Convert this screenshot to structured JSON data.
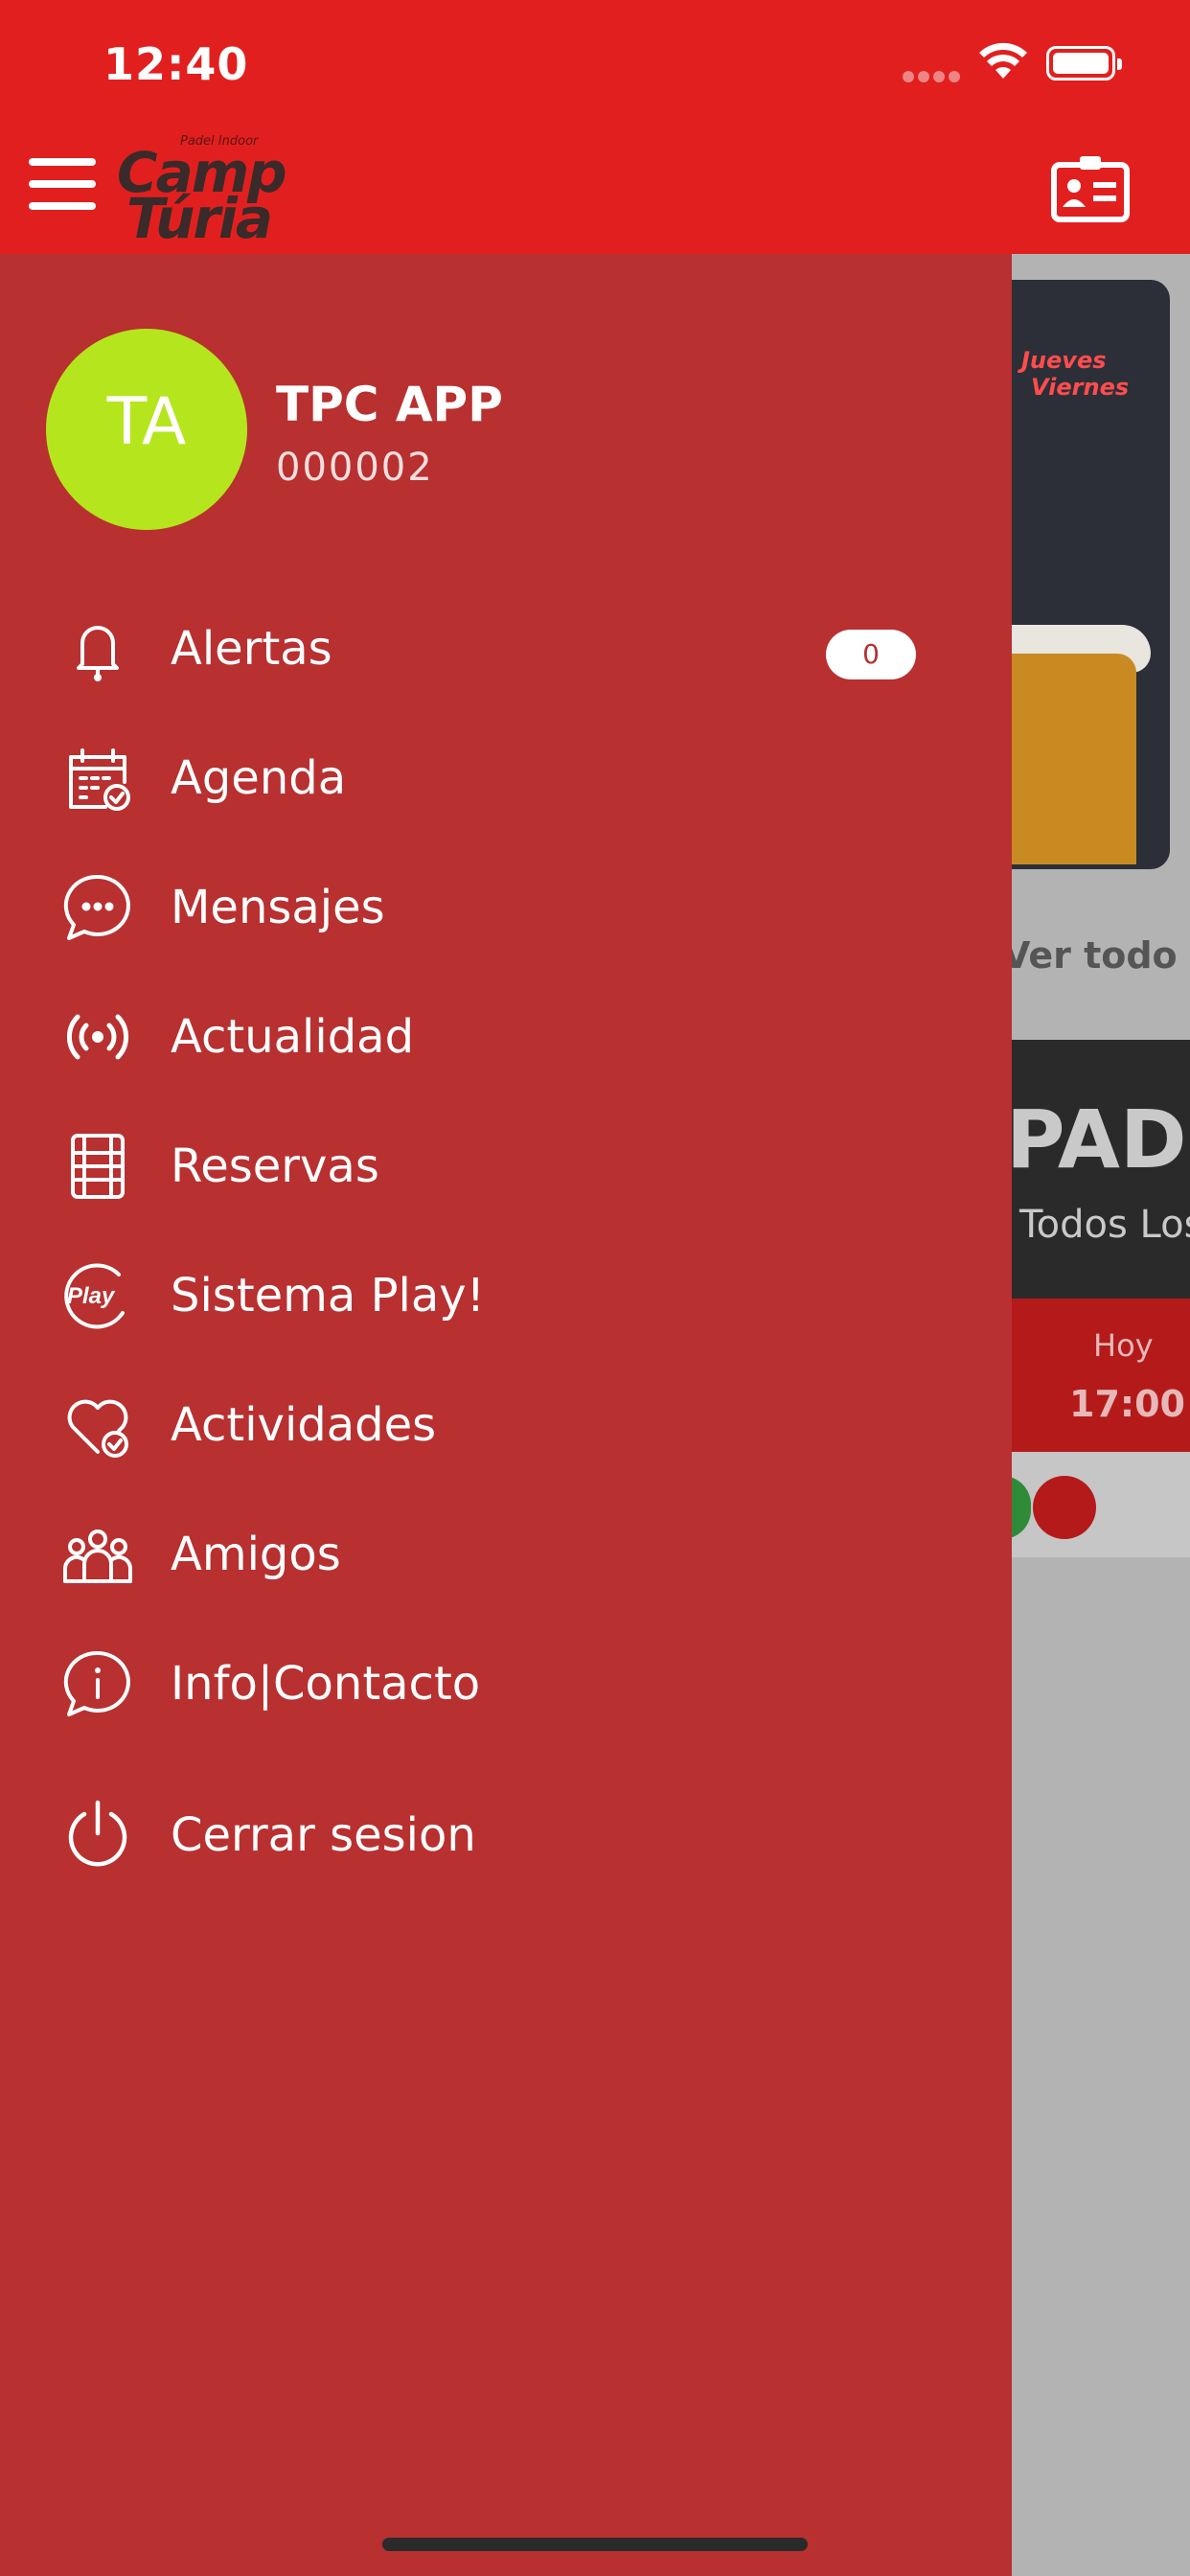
{
  "status_bar": {
    "time": "12:40"
  },
  "header": {
    "logo_small": "Padel Indoor",
    "logo_line1": "Camp",
    "logo_line2": "Túria"
  },
  "profile": {
    "initials": "TA",
    "avatar_color": "#b5e61d",
    "name": "TPC APP",
    "id": "000002"
  },
  "menu": {
    "items": [
      {
        "label": "Alertas",
        "icon": "bell-icon",
        "badge": "0"
      },
      {
        "label": "Agenda",
        "icon": "calendar-check-icon"
      },
      {
        "label": "Mensajes",
        "icon": "chat-bubble-icon"
      },
      {
        "label": "Actualidad",
        "icon": "broadcast-icon"
      },
      {
        "label": "Reservas",
        "icon": "court-icon"
      },
      {
        "label": "Sistema Play!",
        "icon": "play-badge-icon"
      },
      {
        "label": "Actividades",
        "icon": "heart-check-icon"
      },
      {
        "label": "Amigos",
        "icon": "group-icon"
      },
      {
        "label": "Info|Contacto",
        "icon": "info-chat-icon"
      },
      {
        "label": "Cerrar sesion",
        "icon": "power-icon"
      }
    ]
  },
  "background": {
    "banner_text1": "Jueves",
    "banner_text2": "Viernes",
    "see_all": "Ver todo",
    "event_title": "PADEL",
    "event_subtitle": "Todos Los Niveles",
    "event_day": "Hoy",
    "event_time": "17:00"
  },
  "colors": {
    "topbar": "#e21f1f",
    "drawer": "#b83030",
    "overlay": "#b3b3b3"
  }
}
